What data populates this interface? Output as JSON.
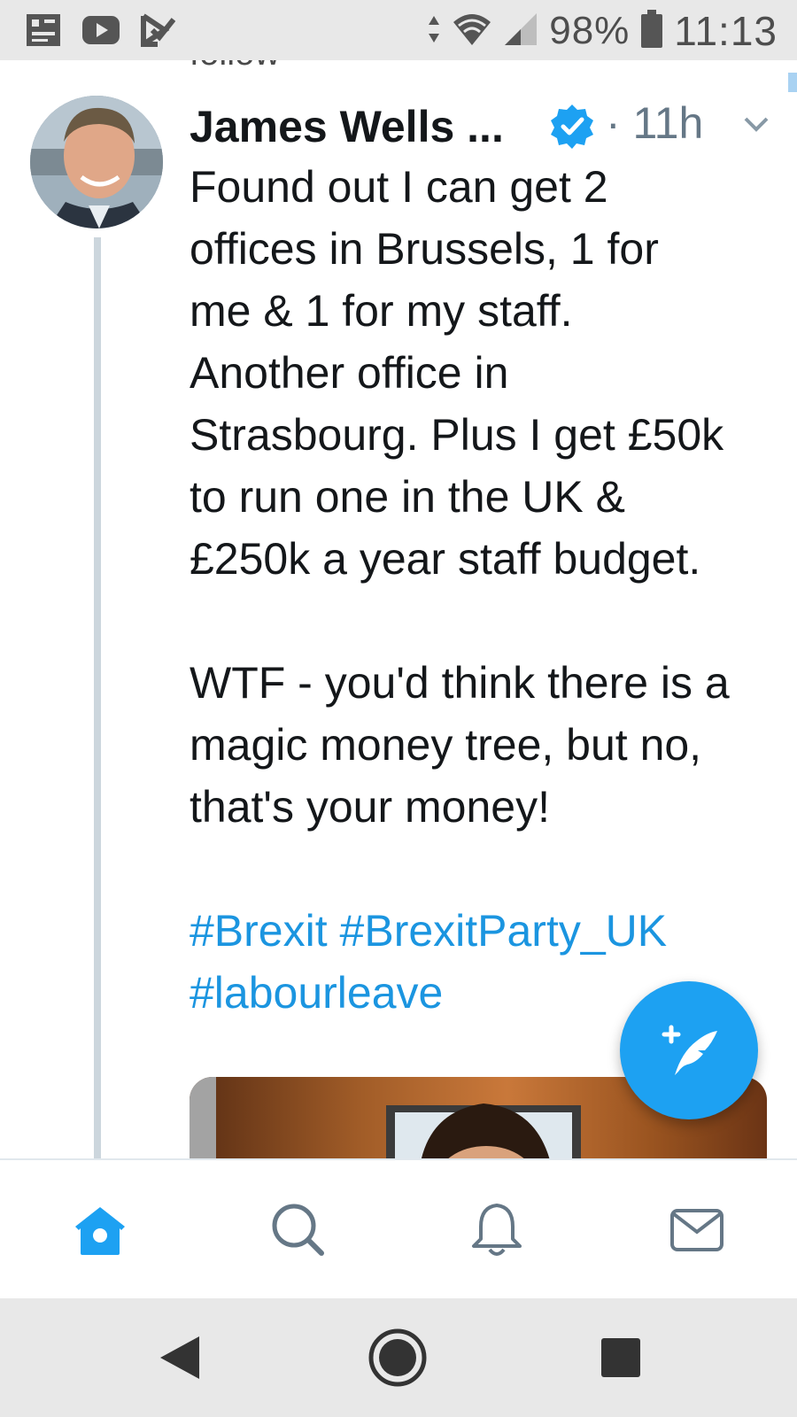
{
  "status_bar": {
    "battery_percent": "98%",
    "time": "11:13",
    "icons": [
      "notification-icon",
      "youtube-icon",
      "tasks-icon",
      "data-arrows-icon",
      "wifi-icon",
      "signal-icon",
      "battery-icon"
    ]
  },
  "tweet": {
    "cut_off_text": "follow",
    "author_name": "James Wells ...",
    "verified": true,
    "timestamp": "· 11h",
    "paragraphs": [
      [
        "Found out I can get 2",
        "offices in Brussels, 1 for",
        "me & 1 for my staff.",
        "Another office in",
        "Strasbourg. Plus I get £50k",
        "to run one in the UK &",
        "£250k a year staff budget."
      ],
      [
        "WTF - you'd think there is a",
        "magic money tree, but no,",
        "that's your money!"
      ]
    ],
    "hashtags": [
      "#Brexit",
      "#BrexitParty_UK",
      "#labourleave"
    ]
  },
  "bottom_tabs": [
    {
      "name": "home",
      "icon": "home-icon",
      "active": true
    },
    {
      "name": "search",
      "icon": "search-icon",
      "active": false
    },
    {
      "name": "notifications",
      "icon": "bell-icon",
      "active": false
    },
    {
      "name": "messages",
      "icon": "mail-icon",
      "active": false
    }
  ],
  "colors": {
    "accent": "#1da1f2",
    "link": "#1b95e0",
    "text": "#14171a",
    "muted": "#657786",
    "status_bar_bg": "#e8e8e8"
  }
}
